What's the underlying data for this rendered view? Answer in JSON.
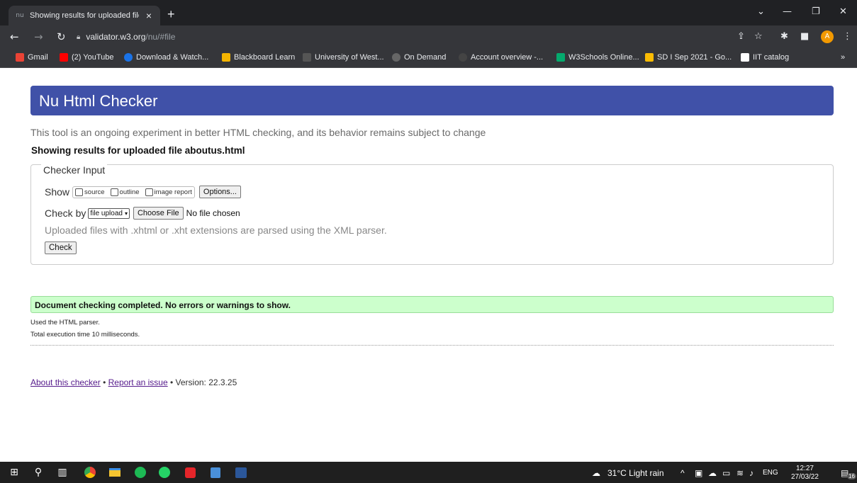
{
  "browser": {
    "tab_title": "Showing results for uploaded file",
    "tab_favicon": "nu",
    "tab_close": "×",
    "new_tab": "+",
    "url_host": "validator.w3.org",
    "url_path": "/nu/#file",
    "profile_initial": "A",
    "bookmarks": [
      {
        "label": "Gmail",
        "color": "#ea4335"
      },
      {
        "label": "(2) YouTube",
        "color": "#ff0000"
      },
      {
        "label": "Download & Watch...",
        "color": "#1a73e8"
      },
      {
        "label": "Blackboard Learn",
        "color": "#f4b400"
      },
      {
        "label": "University of West...",
        "color": "#555555"
      },
      {
        "label": "On Demand",
        "color": "#666666"
      },
      {
        "label": "Account overview -...",
        "color": "#444444"
      },
      {
        "label": "W3Schools Online...",
        "color": "#04aa6d"
      },
      {
        "label": "SD I Sep 2021 - Go...",
        "color": "#fbbc04"
      },
      {
        "label": "IIT catalog",
        "color": "#ffffff"
      }
    ],
    "bookmarks_overflow": "»"
  },
  "page": {
    "title": "Nu Html Checker",
    "subtitle": "This tool is an ongoing experiment in better HTML checking, and its behavior remains subject to change",
    "results_heading": "Showing results for uploaded file aboutus.html",
    "checker": {
      "legend": "Checker Input",
      "show_label": "Show",
      "options": [
        "source",
        "outline",
        "image report"
      ],
      "options_button": "Options...",
      "check_by_label": "Check by",
      "check_by_value": "file upload",
      "choose_file": "Choose File",
      "no_file": "No file chosen",
      "hint": "Uploaded files with .xhtml or .xht extensions are parsed using the XML parser.",
      "check_button": "Check"
    },
    "success_message": "Document checking completed. No errors or warnings to show.",
    "parser_note": "Used the HTML parser.",
    "execution_time": "Total execution time 10 milliseconds.",
    "footer": {
      "about_link": "About this checker",
      "sep1": "•",
      "report_link": "Report an issue",
      "version": "• Version: 22.3.25"
    }
  },
  "taskbar": {
    "weather": "31°C  Light rain",
    "language": "ENG",
    "time": "12:27",
    "date": "27/03/22",
    "notifications": "16",
    "accent": "#1f1f1f"
  }
}
